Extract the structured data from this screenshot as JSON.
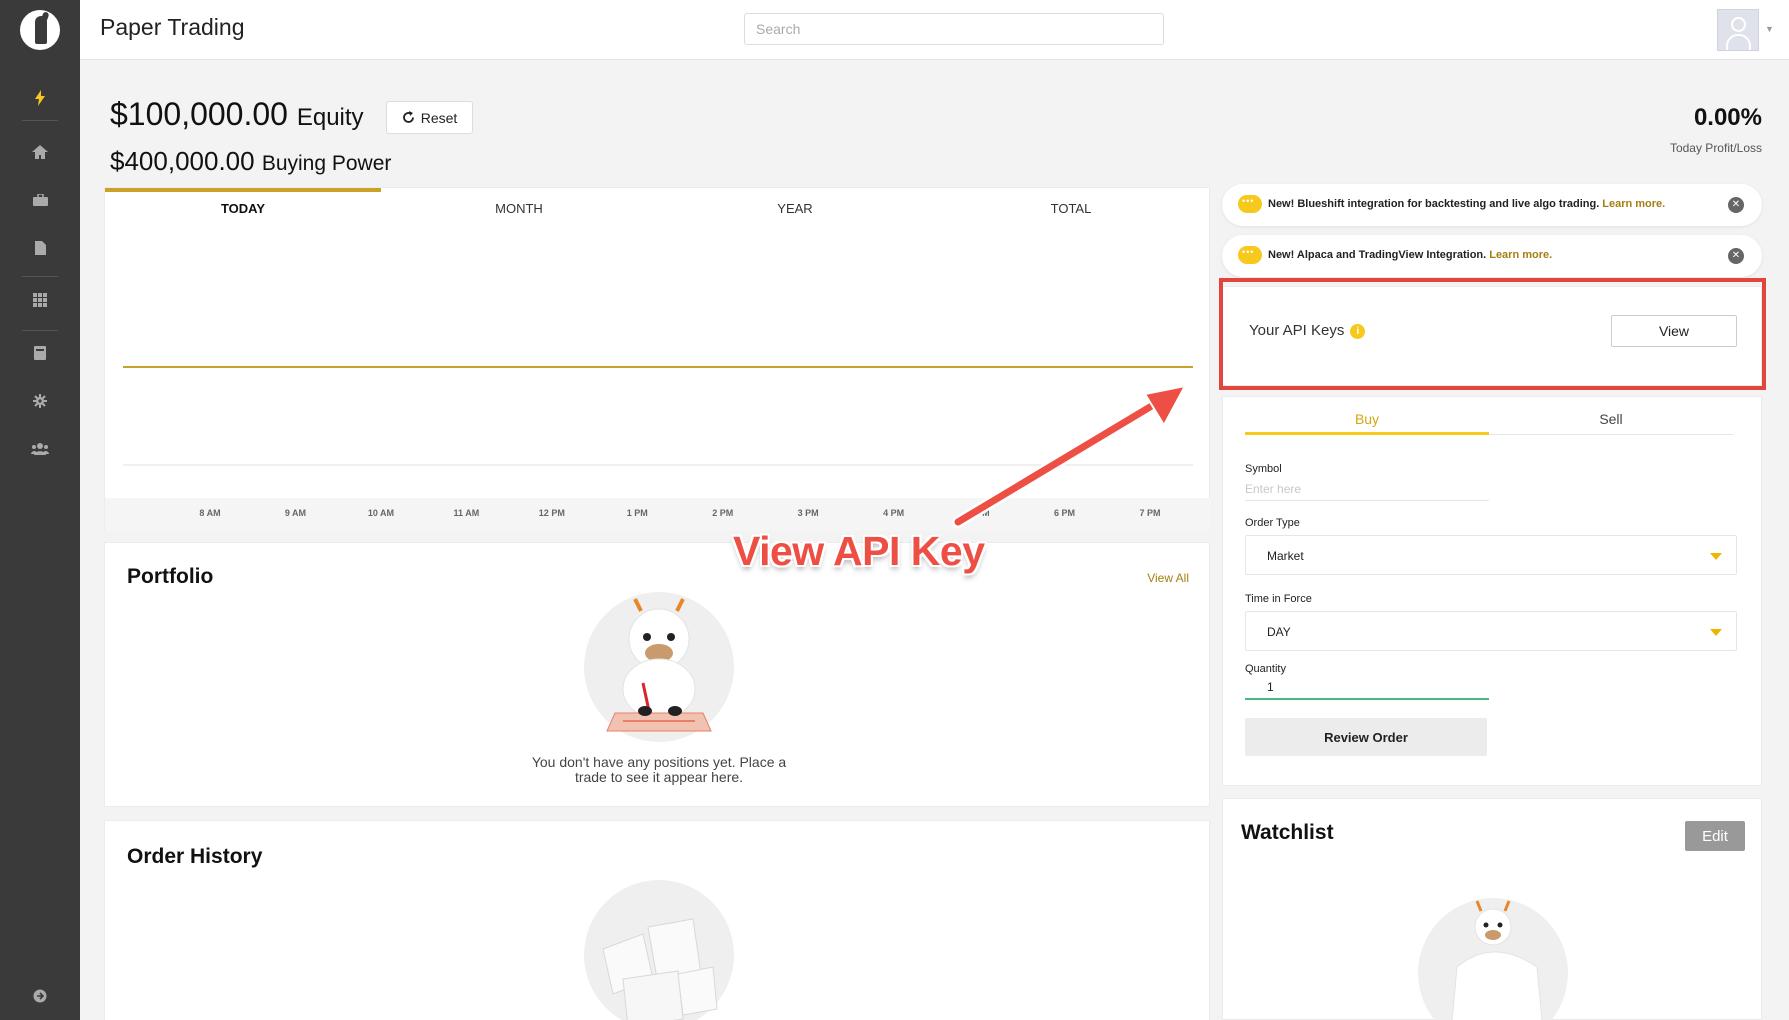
{
  "app": {
    "title": "Paper Trading"
  },
  "search": {
    "placeholder": "Search"
  },
  "header": {
    "equity_value": "$100,000.00",
    "equity_label": "Equity",
    "reset_label": "Reset",
    "buying_power_value": "$400,000.00",
    "buying_power_label": "Buying Power",
    "profit_loss_value": "0.00%",
    "profit_loss_label": "Today Profit/Loss"
  },
  "chart": {
    "tabs": [
      "TODAY",
      "MONTH",
      "YEAR",
      "TOTAL"
    ],
    "active_tab": "TODAY",
    "line_color": "#c9a227"
  },
  "chart_data": {
    "type": "line",
    "x": [
      "8 AM",
      "9 AM",
      "10 AM",
      "11 AM",
      "12 PM",
      "1 PM",
      "2 PM",
      "3 PM",
      "4 PM",
      "5 PM",
      "6 PM",
      "7 PM"
    ],
    "series": [
      {
        "values": [
          100000,
          100000,
          100000,
          100000,
          100000,
          100000,
          100000,
          100000,
          100000,
          100000,
          100000,
          100000
        ]
      }
    ],
    "title": "",
    "xlabel": "",
    "ylabel": "",
    "grid": false
  },
  "portfolio": {
    "title": "Portfolio",
    "view_all": "View All",
    "empty_line1": "You don't have any positions yet. Place a",
    "empty_line2": "trade to see it appear here."
  },
  "order_history": {
    "title": "Order History"
  },
  "banners": [
    {
      "text": "New! Blueshift integration for backtesting and live algo trading.",
      "link": "Learn more."
    },
    {
      "text": "New! Alpaca and TradingView Integration.",
      "link": "Learn more."
    }
  ],
  "api_keys": {
    "label": "Your API Keys",
    "view_label": "View"
  },
  "trade": {
    "buy_label": "Buy",
    "sell_label": "Sell",
    "symbol_label": "Symbol",
    "symbol_placeholder": "Enter here",
    "order_type_label": "Order Type",
    "order_type_value": "Market",
    "tif_label": "Time in Force",
    "tif_value": "DAY",
    "quantity_label": "Quantity",
    "quantity_value": "1",
    "review_label": "Review Order"
  },
  "watchlist": {
    "title": "Watchlist",
    "edit_label": "Edit"
  },
  "annotation": {
    "text": "View API Key",
    "color": "#ee4f44"
  },
  "sidebar": {
    "icons": [
      "lightning-icon",
      "home-icon",
      "briefcase-icon",
      "document-icon",
      "grid-icon",
      "book-icon",
      "gear-icon",
      "users-icon",
      "logout-icon"
    ],
    "accent": "#f6c91c"
  }
}
